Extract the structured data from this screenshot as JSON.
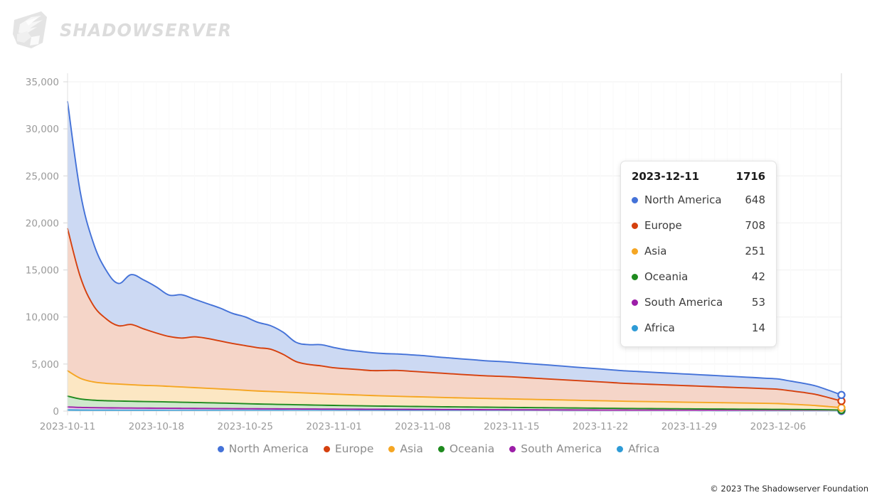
{
  "brand": {
    "name": "SHADOWSERVER",
    "logo_icon": "shadowserver-eagle-logo"
  },
  "footer": {
    "copyright": "© 2023 The Shadowserver Foundation"
  },
  "tooltip": {
    "date": "2023-12-11",
    "total": "1716",
    "rows": [
      {
        "label": "North America",
        "value": "648",
        "color": "#4472d8"
      },
      {
        "label": "Europe",
        "value": "708",
        "color": "#d5400e"
      },
      {
        "label": "Asia",
        "value": "251",
        "color": "#f5a623"
      },
      {
        "label": "Oceania",
        "value": "42",
        "color": "#1e8a1e"
      },
      {
        "label": "South America",
        "value": "53",
        "color": "#9c1ea8"
      },
      {
        "label": "Africa",
        "value": "14",
        "color": "#2e9bd6"
      }
    ]
  },
  "legend": {
    "items": [
      {
        "label": "North America",
        "color": "#4472d8"
      },
      {
        "label": "Europe",
        "color": "#d5400e"
      },
      {
        "label": "Asia",
        "color": "#f5a623"
      },
      {
        "label": "Oceania",
        "color": "#1e8a1e"
      },
      {
        "label": "South America",
        "color": "#9c1ea8"
      },
      {
        "label": "Africa",
        "color": "#2e9bd6"
      }
    ]
  },
  "chart_data": {
    "type": "area",
    "stacked": true,
    "title": "",
    "xlabel": "",
    "ylabel": "",
    "grid": true,
    "legend_position": "bottom",
    "ylim": [
      0,
      35000
    ],
    "yticks": [
      0,
      5000,
      10000,
      15000,
      20000,
      25000,
      30000,
      35000
    ],
    "ytick_labels": [
      "0",
      "5,000",
      "10,000",
      "15,000",
      "20,000",
      "25,000",
      "30,000",
      "35,000"
    ],
    "xtick_labels": [
      "2023-10-11",
      "2023-10-18",
      "2023-10-25",
      "2023-11-01",
      "2023-11-08",
      "2023-11-15",
      "2023-11-22",
      "2023-11-29",
      "2023-12-06"
    ],
    "xtick_indices": [
      0,
      7,
      14,
      21,
      28,
      35,
      42,
      49,
      56
    ],
    "highlight_index": 61,
    "x": [
      "2023-10-11",
      "2023-10-12",
      "2023-10-13",
      "2023-10-14",
      "2023-10-15",
      "2023-10-16",
      "2023-10-17",
      "2023-10-18",
      "2023-10-19",
      "2023-10-20",
      "2023-10-21",
      "2023-10-22",
      "2023-10-23",
      "2023-10-24",
      "2023-10-25",
      "2023-10-26",
      "2023-10-27",
      "2023-10-28",
      "2023-10-29",
      "2023-10-30",
      "2023-10-31",
      "2023-11-01",
      "2023-11-02",
      "2023-11-03",
      "2023-11-04",
      "2023-11-05",
      "2023-11-06",
      "2023-11-07",
      "2023-11-08",
      "2023-11-09",
      "2023-11-10",
      "2023-11-11",
      "2023-11-12",
      "2023-11-13",
      "2023-11-14",
      "2023-11-15",
      "2023-11-16",
      "2023-11-17",
      "2023-11-18",
      "2023-11-19",
      "2023-11-20",
      "2023-11-21",
      "2023-11-22",
      "2023-11-23",
      "2023-11-24",
      "2023-11-25",
      "2023-11-26",
      "2023-11-27",
      "2023-11-28",
      "2023-11-29",
      "2023-11-30",
      "2023-12-01",
      "2023-12-02",
      "2023-12-03",
      "2023-12-04",
      "2023-12-05",
      "2023-12-06",
      "2023-12-07",
      "2023-12-08",
      "2023-12-09",
      "2023-12-10",
      "2023-12-11"
    ],
    "series": [
      {
        "name": "Africa",
        "color": "#2e9bd6",
        "fill": "#d4ecf8",
        "values": [
          120,
          100,
          92,
          88,
          84,
          80,
          78,
          76,
          74,
          72,
          70,
          68,
          66,
          64,
          62,
          60,
          58,
          56,
          54,
          52,
          50,
          48,
          46,
          45,
          44,
          43,
          42,
          41,
          40,
          39,
          38,
          37,
          36,
          35,
          34,
          33,
          32,
          31,
          30,
          29,
          28,
          27,
          26,
          25,
          24,
          23,
          22,
          22,
          21,
          21,
          20,
          20,
          19,
          19,
          18,
          18,
          17,
          17,
          16,
          16,
          15,
          14
        ]
      },
      {
        "name": "South America",
        "color": "#9c1ea8",
        "fill": "#e8cdec",
        "values": [
          320,
          290,
          270,
          258,
          250,
          244,
          238,
          232,
          226,
          220,
          214,
          208,
          202,
          196,
          190,
          186,
          182,
          178,
          174,
          170,
          166,
          162,
          158,
          154,
          150,
          146,
          142,
          138,
          134,
          130,
          126,
          122,
          118,
          114,
          110,
          107,
          104,
          101,
          98,
          95,
          92,
          89,
          86,
          83,
          80,
          78,
          76,
          74,
          72,
          70,
          68,
          66,
          65,
          63,
          62,
          61,
          60,
          59,
          57,
          56,
          55,
          53
        ]
      },
      {
        "name": "Oceania",
        "color": "#1e8a1e",
        "fill": "#cfe8cd",
        "values": [
          1150,
          900,
          800,
          760,
          740,
          720,
          700,
          690,
          670,
          650,
          630,
          610,
          590,
          570,
          540,
          510,
          490,
          470,
          450,
          430,
          410,
          395,
          380,
          365,
          350,
          340,
          330,
          320,
          310,
          300,
          290,
          282,
          274,
          266,
          258,
          250,
          242,
          234,
          226,
          218,
          210,
          202,
          194,
          186,
          178,
          172,
          166,
          160,
          154,
          148,
          142,
          136,
          130,
          124,
          118,
          112,
          106,
          100,
          92,
          84,
          68,
          42
        ]
      },
      {
        "name": "Asia",
        "color": "#f5a623",
        "fill": "#fce7c3",
        "values": [
          2700,
          2200,
          1950,
          1850,
          1800,
          1760,
          1720,
          1700,
          1660,
          1620,
          1580,
          1540,
          1500,
          1460,
          1420,
          1380,
          1350,
          1320,
          1290,
          1260,
          1230,
          1200,
          1170,
          1140,
          1110,
          1085,
          1060,
          1040,
          1020,
          1000,
          980,
          960,
          945,
          930,
          915,
          900,
          885,
          870,
          855,
          840,
          825,
          810,
          795,
          780,
          765,
          752,
          740,
          728,
          716,
          704,
          692,
          680,
          668,
          656,
          644,
          632,
          620,
          560,
          500,
          430,
          340,
          251
        ]
      },
      {
        "name": "Europe",
        "color": "#d5400e",
        "fill": "#f5d5c8",
        "values": [
          15100,
          10800,
          8200,
          6900,
          6200,
          6400,
          6000,
          5600,
          5300,
          5200,
          5400,
          5300,
          5100,
          4900,
          4750,
          4600,
          4500,
          4000,
          3300,
          3050,
          2950,
          2800,
          2750,
          2700,
          2650,
          2700,
          2750,
          2700,
          2650,
          2600,
          2550,
          2500,
          2450,
          2400,
          2380,
          2350,
          2300,
          2250,
          2200,
          2150,
          2100,
          2050,
          2000,
          1950,
          1900,
          1870,
          1840,
          1810,
          1780,
          1750,
          1720,
          1690,
          1660,
          1630,
          1600,
          1560,
          1520,
          1420,
          1320,
          1180,
          950,
          708
        ]
      },
      {
        "name": "North America",
        "color": "#4472d8",
        "fill": "#ccd9f3",
        "values": [
          13500,
          9000,
          6700,
          5200,
          4500,
          5300,
          5200,
          4900,
          4400,
          4600,
          4000,
          3700,
          3500,
          3200,
          3050,
          2700,
          2500,
          2350,
          2050,
          2100,
          2250,
          2150,
          2000,
          1950,
          1900,
          1800,
          1750,
          1750,
          1750,
          1700,
          1680,
          1650,
          1630,
          1600,
          1580,
          1550,
          1520,
          1500,
          1480,
          1450,
          1420,
          1400,
          1380,
          1350,
          1330,
          1310,
          1290,
          1270,
          1250,
          1230,
          1210,
          1190,
          1170,
          1150,
          1130,
          1110,
          1090,
          1030,
          970,
          900,
          780,
          648
        ]
      }
    ]
  }
}
